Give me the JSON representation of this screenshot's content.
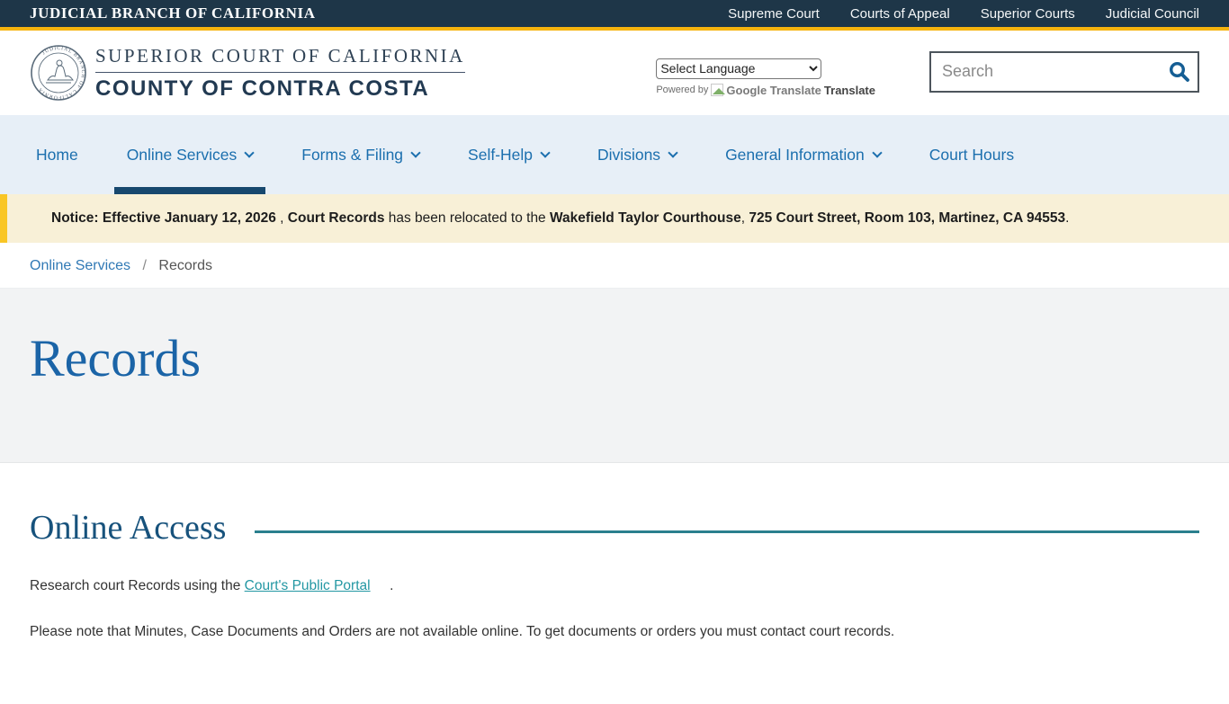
{
  "topbar": {
    "brand": "JUDICIAL BRANCH OF CALIFORNIA",
    "links": [
      {
        "label": "Supreme Court"
      },
      {
        "label": "Courts of Appeal"
      },
      {
        "label": "Superior Courts"
      },
      {
        "label": "Judicial Council"
      }
    ]
  },
  "header": {
    "title_line1": "SUPERIOR COURT OF CALIFORNIA",
    "title_line2": "COUNTY OF CONTRA COSTA",
    "language_select": {
      "selected": "Select Language"
    },
    "translate_attribution": {
      "powered_by": "Powered by",
      "brand": "Google Translate",
      "label": "Translate"
    },
    "search": {
      "placeholder": "Search"
    }
  },
  "nav": {
    "items": [
      {
        "label": "Home"
      },
      {
        "label": "Online Services"
      },
      {
        "label": "Forms & Filing"
      },
      {
        "label": "Self-Help"
      },
      {
        "label": "Divisions"
      },
      {
        "label": "General Information"
      },
      {
        "label": "Court Hours"
      }
    ]
  },
  "notice": {
    "segments": [
      {
        "text": "Notice: Effective January 12, 2026",
        "bold": true
      },
      {
        "text": " , ",
        "bold": false
      },
      {
        "text": "Court Records",
        "bold": true
      },
      {
        "text": " has been relocated to the ",
        "bold": false
      },
      {
        "text": "Wakefield Taylor Courthouse",
        "bold": true
      },
      {
        "text": ", ",
        "bold": false
      },
      {
        "text": "725 Court Street, Room 103, Martinez, CA 94553",
        "bold": true
      },
      {
        "text": ".",
        "bold": false
      }
    ]
  },
  "breadcrumb": {
    "parent": "Online Services",
    "separator": "/",
    "current": "Records"
  },
  "page": {
    "title": "Records"
  },
  "content": {
    "section_heading": "Online Access",
    "paragraph1_segments": [
      {
        "text": "Research court Records using the "
      },
      {
        "text": "Court's Public Portal",
        "link": true
      },
      {
        "text": "     ."
      }
    ],
    "paragraph2": "Please note that Minutes, Case Documents and Orders are not available online. To get documents or orders you must contact court records."
  },
  "colors": {
    "accent_gold": "#f6b40e",
    "topbar_navy": "#1e3648",
    "nav_background": "#e7eff7",
    "nav_link_blue": "#1b6fae",
    "active_tab_navy": "#17486e",
    "page_title_blue": "#1b64a7",
    "section_heading_navy": "#17527c",
    "section_rule_teal": "#2a7f8e",
    "inline_link_teal": "#2397a3",
    "notice_background": "#f8f0d7",
    "notice_border_gold": "#f9c625"
  }
}
